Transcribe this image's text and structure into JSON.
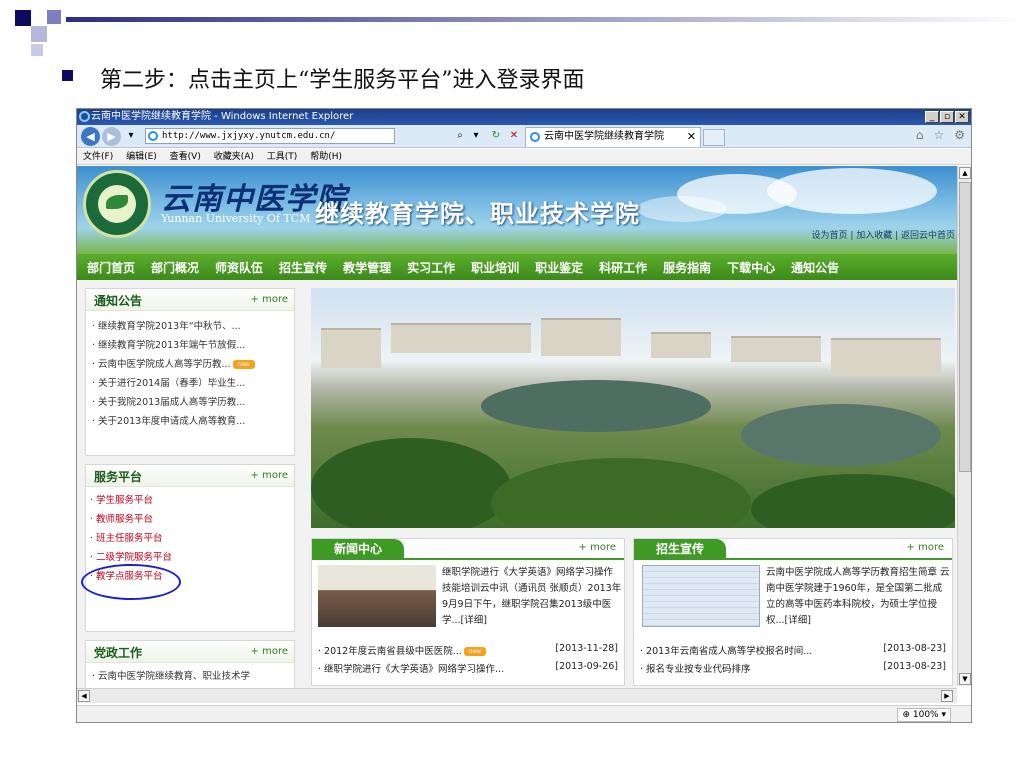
{
  "slide": {
    "step_text": "第二步：点击主页上“学生服务平台”进入登录界面"
  },
  "browser": {
    "window_title": "云南中医学院继续教育学院 - Windows Internet Explorer",
    "address": "http://www.jxjyxy.ynutcm.edu.cn/",
    "tab_title": "云南中医学院继续教育学院",
    "menu": [
      "文件(F)",
      "编辑(E)",
      "查看(V)",
      "收藏夹(A)",
      "工具(T)",
      "帮助(H)"
    ],
    "zoom": "100%"
  },
  "site": {
    "logo_cn": "云南中医学院",
    "logo_en": "Yunnan University Of TCM",
    "title": "继续教育学院、职业技术学院",
    "top_links": "设为首页 | 加入收藏 | 返回云中首页",
    "nav": [
      "部门首页",
      "部门概况",
      "师资队伍",
      "招生宣传",
      "教学管理",
      "实习工作",
      "职业培训",
      "职业鉴定",
      "科研工作",
      "服务指南",
      "下载中心",
      "通知公告"
    ]
  },
  "notice": {
    "title": "通知公告",
    "more": "+ more",
    "items": [
      "· 继续教育学院2013年“中秋节、...",
      "· 继续教育学院2013年端午节放假...",
      "· 云南中医学院成人高等学历教...",
      "· 关于进行2014届（春季）毕业生...",
      "· 关于我院2013届成人高等学历教...",
      "· 关于2013年度申请成人高等教育..."
    ],
    "badge": "new"
  },
  "service": {
    "title": "服务平台",
    "more": "+ more",
    "items": [
      "· 学生服务平台",
      "· 教师服务平台",
      "· 班主任服务平台",
      "· 二级学院服务平台",
      "· 教学点服务平台"
    ]
  },
  "party": {
    "title": "党政工作",
    "more": "+ more",
    "item": "· 云南中医学院继续教育、职业技术学"
  },
  "news": {
    "title": "新闻中心",
    "more": "+ more",
    "text": "继职学院进行《大学英语》网络学习操作技能培训云中讯（通讯员 张顺贞）2013年9月9日下午，继职学院召集2013级中医学...[详细]",
    "rows": [
      {
        "text": "· 2012年度云南省县级中医医院...",
        "date": "[2013-11-28]"
      },
      {
        "text": "· 继职学院进行《大学英语》网络学习操作...",
        "date": "[2013-09-26]"
      }
    ]
  },
  "recruit": {
    "title": "招生宣传",
    "more": "+ more",
    "text": "云南中医学院成人高等学历教育招生简章 云南中医学院建于1960年，是全国第二批成立的高等中医药本科院校，为硕士学位授权...[详细]",
    "rows": [
      {
        "text": "· 2013年云南省成人高等学校报名时间...",
        "date": "[2013-08-23]"
      },
      {
        "text": "· 报名专业按专业代码排序",
        "date": "[2013-08-23]"
      }
    ]
  }
}
